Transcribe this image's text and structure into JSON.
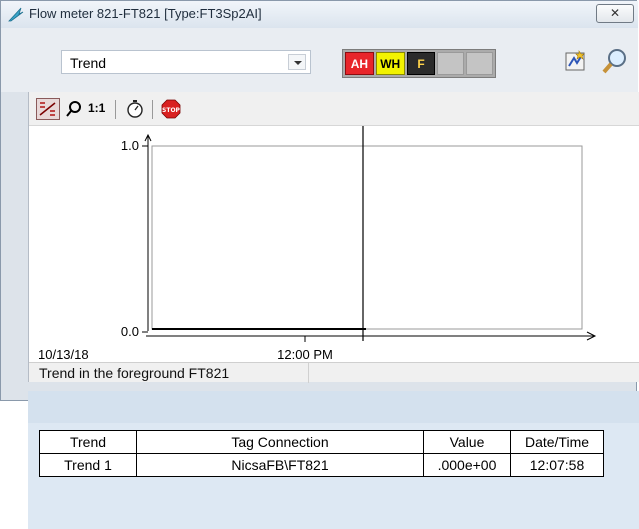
{
  "window": {
    "title": "Flow meter 821-FT821  [Type:FT3Sp2AI]",
    "close_label": "✕"
  },
  "toolbar": {
    "view_selected": "Trend",
    "alarms": [
      {
        "label": "AH",
        "color": "#e8252a"
      },
      {
        "label": "WH",
        "color": "#f2f200"
      },
      {
        "label": "F",
        "color": "#2b2b2b"
      },
      {
        "label": "",
        "color": "#c4c4c4"
      },
      {
        "label": "",
        "color": "#c4c4c4"
      }
    ]
  },
  "trend_tools": {
    "one_to_one_label": "1:1"
  },
  "chart_data": {
    "type": "line",
    "y_ticks": [
      "1.0",
      "0.0"
    ],
    "ylim": [
      0.0,
      1.0
    ],
    "x_ticks": [
      "10/13/18",
      "12:00 PM"
    ],
    "series": [],
    "cursor": "present"
  },
  "status": {
    "text": "Trend in the foreground FT821"
  },
  "connections": {
    "columns": [
      "Trend",
      "Tag Connection",
      "Value",
      "Date/Time"
    ],
    "rows": [
      {
        "trend": "Trend 1",
        "tag": "NicsaFB\\FT821",
        "value": ".000e+00",
        "datetime": "12:07:58"
      }
    ]
  }
}
